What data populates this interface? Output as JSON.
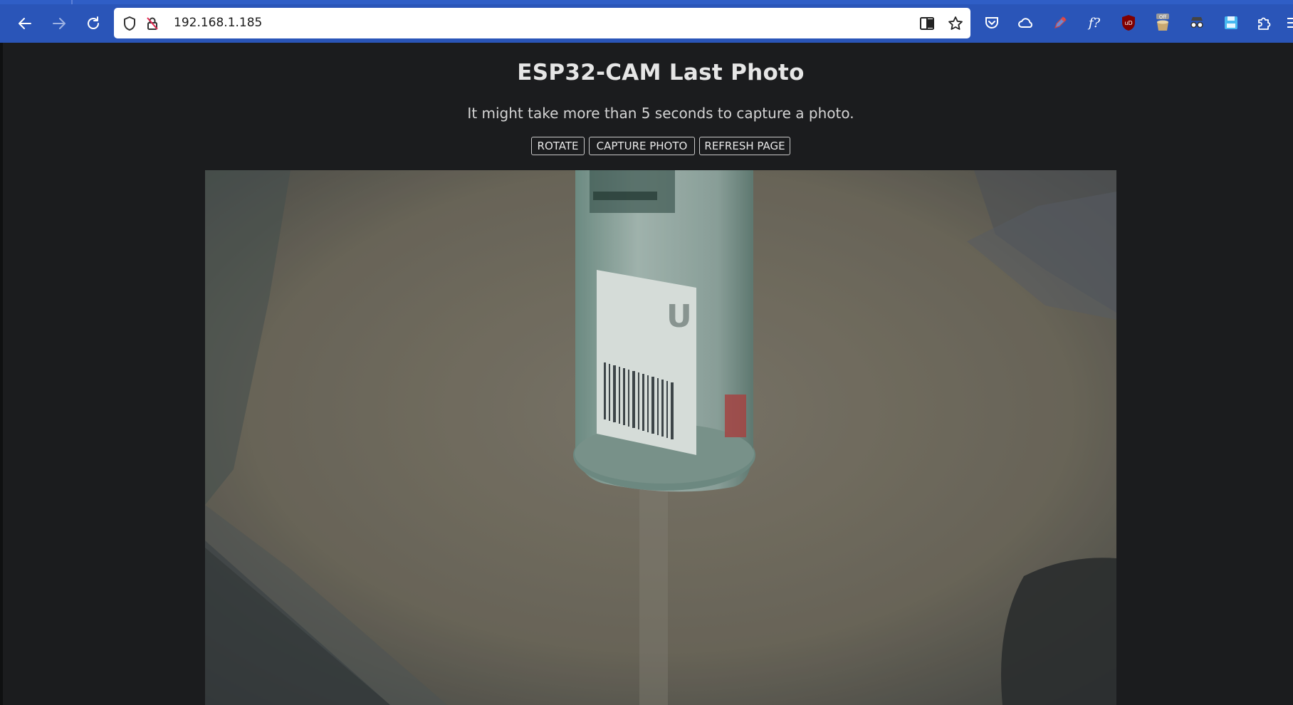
{
  "browser": {
    "url": "192.168.1.185",
    "back_icon": "arrow-left-icon",
    "forward_icon": "arrow-right-icon",
    "reload_icon": "reload-icon",
    "tracking_icon": "shield-icon",
    "insecure_icon": "insecure-lock-icon",
    "reader_icon": "reader-view-icon",
    "bookmark_icon": "star-icon",
    "extensions": [
      "pocket-icon",
      "cloud-icon",
      "pen-icon",
      "formula-icon",
      "ublock-icon",
      "cookie-off-icon",
      "spy-icon",
      "save-icon",
      "puzzle-icon",
      "menu-icon"
    ],
    "cookie_badge": "Off",
    "ublock_badge": "uD",
    "formula_label": "f?"
  },
  "page": {
    "title": "ESP32-CAM Last Photo",
    "subtitle": "It might take more than 5 seconds to capture a photo.",
    "buttons": {
      "rotate": "ROTATE",
      "capture": "CAPTURE PHOTO",
      "refresh": "REFRESH PAGE"
    },
    "photo": {
      "description_icon": "camera-photo-image",
      "label_letter": "U"
    }
  },
  "colors": {
    "chrome": "#2a55b8",
    "page_bg": "#1b1c1e",
    "text": "#e6e6e6"
  }
}
